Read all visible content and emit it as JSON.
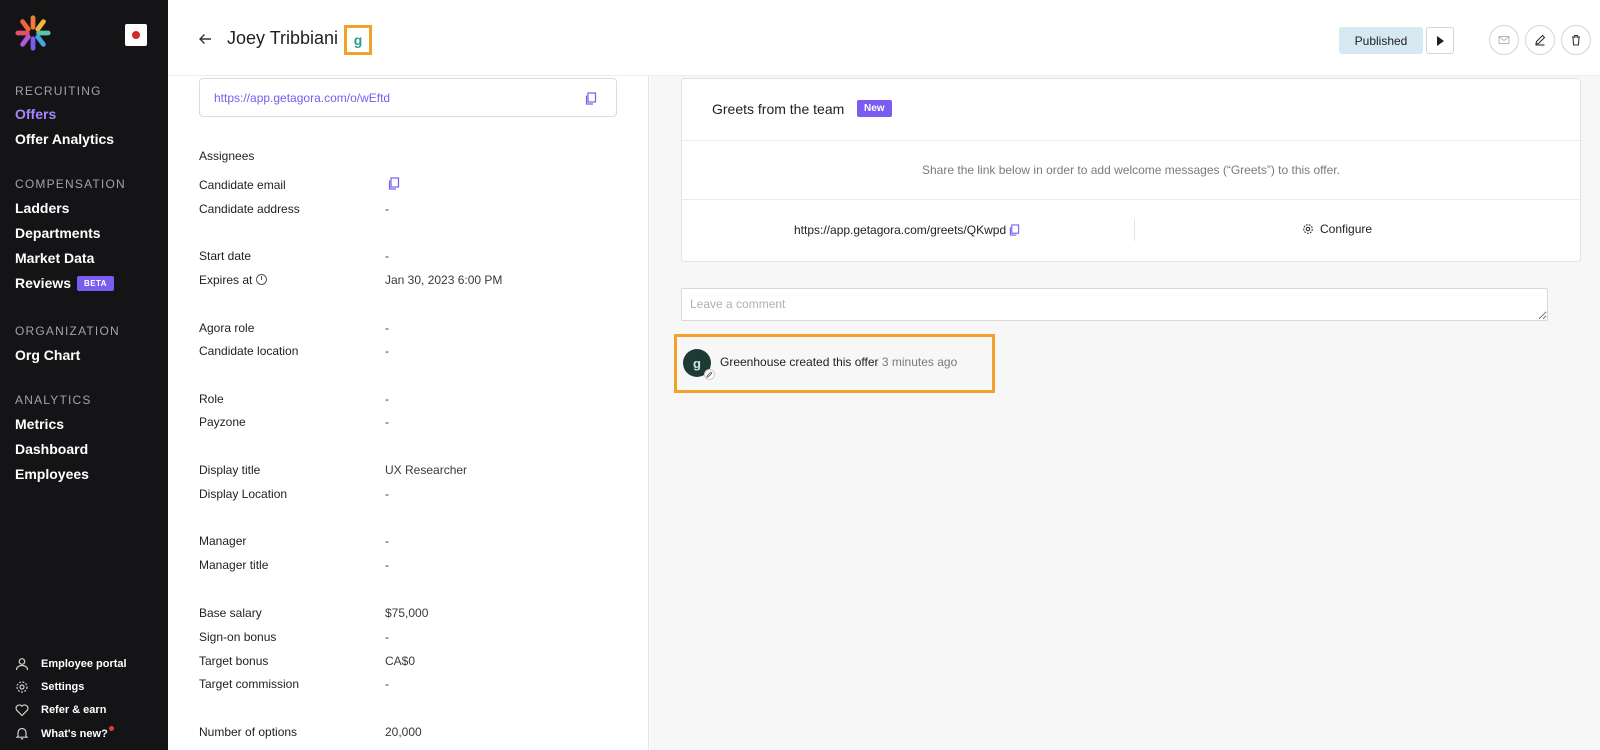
{
  "sidebar": {
    "sections": {
      "recruiting": "RECRUITING",
      "compensation": "COMPENSATION",
      "organization": "ORGANIZATION",
      "analytics": "ANALYTICS"
    },
    "items": {
      "offers": "Offers",
      "offer_analytics": "Offer Analytics",
      "ladders": "Ladders",
      "departments": "Departments",
      "market_data": "Market Data",
      "reviews": "Reviews",
      "reviews_badge": "BETA",
      "org_chart": "Org Chart",
      "metrics": "Metrics",
      "dashboard": "Dashboard",
      "employees": "Employees"
    },
    "bottom": {
      "employee_portal": "Employee portal",
      "settings": "Settings",
      "refer_earn": "Refer & earn",
      "whats_new": "What's new?"
    },
    "accent_color": "#a785ff"
  },
  "header": {
    "title": "Joey Tribbiani",
    "status_button": "Published"
  },
  "details": {
    "offer_link": "https://app.getagora.com/o/wEftd",
    "rows": {
      "assignees": "Assignees",
      "candidate_email": "Candidate email",
      "candidate_address": "Candidate address",
      "candidate_address_value": "-",
      "start_date": "Start date",
      "start_date_value": "-",
      "expires_at": "Expires at",
      "expires_at_value": "Jan 30, 2023 6:00 PM",
      "agora_role": "Agora role",
      "agora_role_value": "-",
      "candidate_location": "Candidate location",
      "candidate_location_value": "-",
      "role": "Role",
      "role_value": "-",
      "payzone": "Payzone",
      "payzone_value": "-",
      "display_title": "Display title",
      "display_title_value": "UX Researcher",
      "display_location": "Display Location",
      "display_location_value": "-",
      "manager": "Manager",
      "manager_value": "-",
      "manager_title": "Manager title",
      "manager_title_value": "-",
      "base_salary": "Base salary",
      "base_salary_value": "$75,000",
      "sign_on_bonus": "Sign-on bonus",
      "sign_on_bonus_value": "-",
      "target_bonus": "Target bonus",
      "target_bonus_value": "CA$0",
      "target_commission": "Target commission",
      "target_commission_value": "-",
      "number_of_options": "Number of options",
      "number_of_options_value": "20,000"
    }
  },
  "greets": {
    "title": "Greets from the team",
    "badge": "New",
    "description": "Share the link below in order to add welcome messages (“Greets”) to this offer.",
    "link": "https://app.getagora.com/greets/QKwpd",
    "configure_label": "Configure"
  },
  "comment": {
    "placeholder": "Leave a comment"
  },
  "activity": {
    "avatar_glyph": "g",
    "text": "Greenhouse created this offer",
    "time": "3 minutes ago"
  },
  "colors": {
    "highlight": "#f3a12d",
    "purple": "#7b5cf0",
    "published_bg": "#d6e9f3"
  }
}
